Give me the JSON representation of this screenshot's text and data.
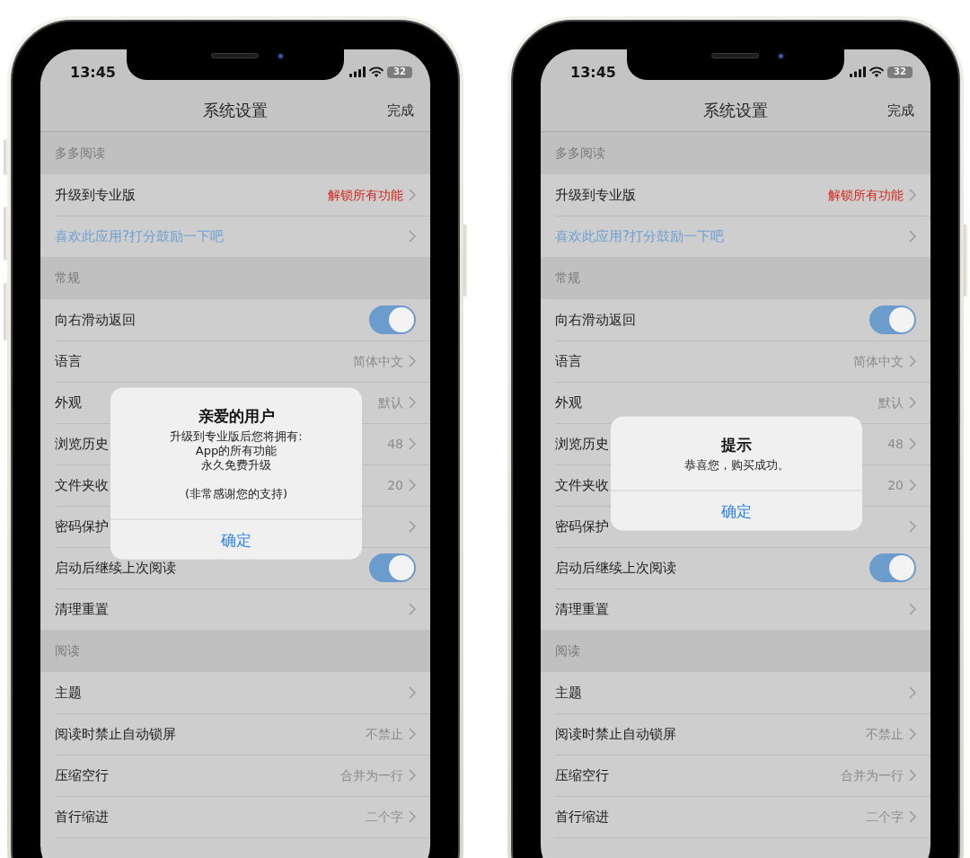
{
  "phones": [
    {
      "status_bar": {
        "time": "13:45",
        "battery": "32"
      },
      "nav_bar": {
        "title": "系统设置",
        "action": "完成"
      },
      "sections": [
        {
          "header": "多多阅读",
          "rows": [
            {
              "kind": "promo",
              "label": "升级到专业版",
              "value": "解锁所有功能"
            },
            {
              "kind": "link",
              "label": "喜欢此应用?打分鼓励一下吧"
            }
          ]
        },
        {
          "header": "常规",
          "rows": [
            {
              "kind": "switch",
              "label": "向右滑动返回",
              "on": true
            },
            {
              "kind": "detail",
              "label": "语言",
              "value": "简体中文"
            },
            {
              "kind": "detail",
              "label": "外观",
              "value": "默认"
            },
            {
              "kind": "detail",
              "label": "浏览历史",
              "value": "48"
            },
            {
              "kind": "detail",
              "label": "文件夹收",
              "value": "20"
            },
            {
              "kind": "detail",
              "label": "密码保护"
            },
            {
              "kind": "switch",
              "label": "启动后继续上次阅读",
              "on": true
            },
            {
              "kind": "detail",
              "label": "清理重置"
            }
          ]
        },
        {
          "header": "阅读",
          "rows": [
            {
              "kind": "detail",
              "label": "主题"
            },
            {
              "kind": "detail",
              "label": "阅读时禁止自动锁屏",
              "value": "不禁止"
            },
            {
              "kind": "detail",
              "label": "压缩空行",
              "value": "合并为一行"
            },
            {
              "kind": "detail",
              "label": "首行缩进",
              "value": "二个字"
            }
          ]
        }
      ],
      "alert": {
        "title": "亲爱的用户",
        "message": [
          {
            "lines": [
              "升级到专业版后您将拥有:",
              "App的所有功能",
              "永久免费升级"
            ]
          },
          {
            "lines": [
              "(非常感谢您的支持)"
            ]
          }
        ],
        "button": "确定"
      }
    },
    {
      "status_bar": {
        "time": "13:45",
        "battery": "32"
      },
      "nav_bar": {
        "title": "系统设置",
        "action": "完成"
      },
      "sections": [
        {
          "header": "多多阅读",
          "rows": [
            {
              "kind": "promo",
              "label": "升级到专业版",
              "value": "解锁所有功能"
            },
            {
              "kind": "link",
              "label": "喜欢此应用?打分鼓励一下吧"
            }
          ]
        },
        {
          "header": "常规",
          "rows": [
            {
              "kind": "switch",
              "label": "向右滑动返回",
              "on": true
            },
            {
              "kind": "detail",
              "label": "语言",
              "value": "简体中文"
            },
            {
              "kind": "detail",
              "label": "外观",
              "value": "默认"
            },
            {
              "kind": "detail",
              "label": "浏览历史",
              "value": "48"
            },
            {
              "kind": "detail",
              "label": "文件夹收",
              "value": "20"
            },
            {
              "kind": "detail",
              "label": "密码保护"
            },
            {
              "kind": "switch",
              "label": "启动后继续上次阅读",
              "on": true
            },
            {
              "kind": "detail",
              "label": "清理重置"
            }
          ]
        },
        {
          "header": "阅读",
          "rows": [
            {
              "kind": "detail",
              "label": "主题"
            },
            {
              "kind": "detail",
              "label": "阅读时禁止自动锁屏",
              "value": "不禁止"
            },
            {
              "kind": "detail",
              "label": "压缩空行",
              "value": "合并为一行"
            },
            {
              "kind": "detail",
              "label": "首行缩进",
              "value": "二个字"
            }
          ]
        }
      ],
      "alert": {
        "title": "提示",
        "message": [
          {
            "lines": [
              "恭喜您，购买成功。"
            ]
          }
        ],
        "button": "确定"
      }
    }
  ]
}
